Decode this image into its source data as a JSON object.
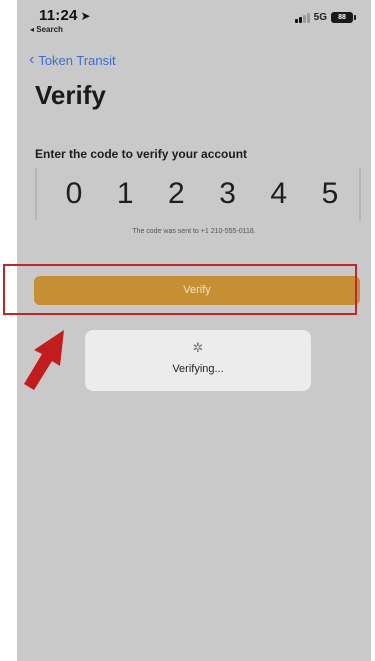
{
  "status_bar": {
    "time": "11:24",
    "back_app": "◂ Search",
    "network": "5G",
    "battery": "88"
  },
  "nav": {
    "back_label": "Token Transit"
  },
  "page": {
    "title": "Verify",
    "instructions": "Enter the code to verify your account",
    "code_digits": [
      "0",
      "1",
      "2",
      "3",
      "4",
      "5"
    ],
    "sent_note": "The code was sent to +1 210-555-0118."
  },
  "verify_button": {
    "label": "Verify"
  },
  "toast": {
    "text": "Verifying..."
  },
  "colors": {
    "accent": "#c68f34",
    "link": "#3a6fcf",
    "highlight": "#c0262a",
    "screen_bg": "#c9c9c9"
  }
}
